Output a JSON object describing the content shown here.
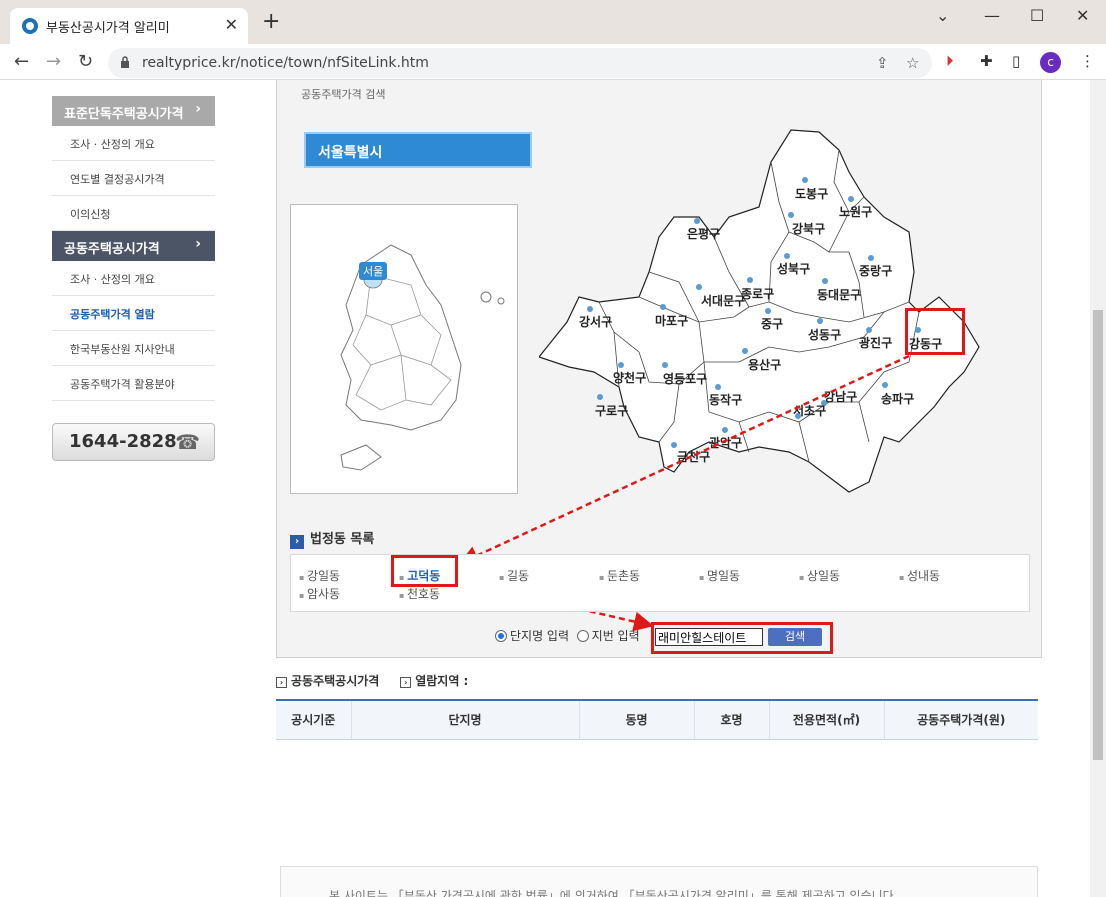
{
  "browser": {
    "tab_title": "부동산공시가격 알리미",
    "url": "realtyprice.kr/notice/town/nfSiteLink.htm",
    "profile_initial": "c"
  },
  "sidebar": {
    "sections": [
      {
        "label": "표준단독주택공시가격",
        "color": "#a9a9a9",
        "items": [
          "조사 · 산정의 개요",
          "연도별 결정공시가격",
          "이의신청"
        ]
      },
      {
        "label": "공동주택공시가격",
        "color": "#4b5565",
        "items": [
          "조사 · 산정의 개요",
          "공동주택가격 열람",
          "한국부동산원 지사안내",
          "공동주택가격 활용분야"
        ]
      }
    ],
    "active_item": "공동주택가격 열람",
    "phone": "1644-2828"
  },
  "main": {
    "subtitle": "공동주택가격 검색",
    "region_title": "서울특별시",
    "korea_label": "서울",
    "districts": [
      {
        "name": "도봉구"
      },
      {
        "name": "노원구"
      },
      {
        "name": "강북구"
      },
      {
        "name": "은평구"
      },
      {
        "name": "중랑구"
      },
      {
        "name": "성북구"
      },
      {
        "name": "종로구"
      },
      {
        "name": "동대문구"
      },
      {
        "name": "서대문구"
      },
      {
        "name": "강서구"
      },
      {
        "name": "마포구"
      },
      {
        "name": "중구"
      },
      {
        "name": "성동구"
      },
      {
        "name": "광진구"
      },
      {
        "name": "강동구"
      },
      {
        "name": "양천구"
      },
      {
        "name": "영등포구"
      },
      {
        "name": "용산구"
      },
      {
        "name": "동작구"
      },
      {
        "name": "송파구"
      },
      {
        "name": "구로구"
      },
      {
        "name": "강남구"
      },
      {
        "name": "서초구"
      },
      {
        "name": "관악구"
      },
      {
        "name": "금천구"
      }
    ],
    "selected_district": "강동구",
    "dong_list_title": "법정동 목록",
    "dongs": [
      "강일동",
      "고덕동",
      "길동",
      "둔촌동",
      "명일동",
      "상일동",
      "성내동",
      "암사동",
      "천호동"
    ],
    "selected_dong": "고덕동",
    "search": {
      "radio_complex": "단지명 입력",
      "radio_lot": "지번 입력",
      "input_value": "래미안힐스테이트",
      "button": "검색"
    }
  },
  "results": {
    "label_price": "공동주택공시가격",
    "label_region": "열람지역 :",
    "columns": [
      "공시기준",
      "단지명",
      "동명",
      "호명",
      "전용면적(㎡)",
      "공동주택가격(원)"
    ]
  },
  "footer": {
    "text": "본 사이트는 「부동산 가격공시에 관한 법률」에 의거하여 「부동산공시가격 알리미」를 통해 제공하고 있습니다."
  },
  "colors": {
    "accent": "#2f8ad6",
    "highlight": "#e01818",
    "table_border": "#3f6fb3"
  }
}
